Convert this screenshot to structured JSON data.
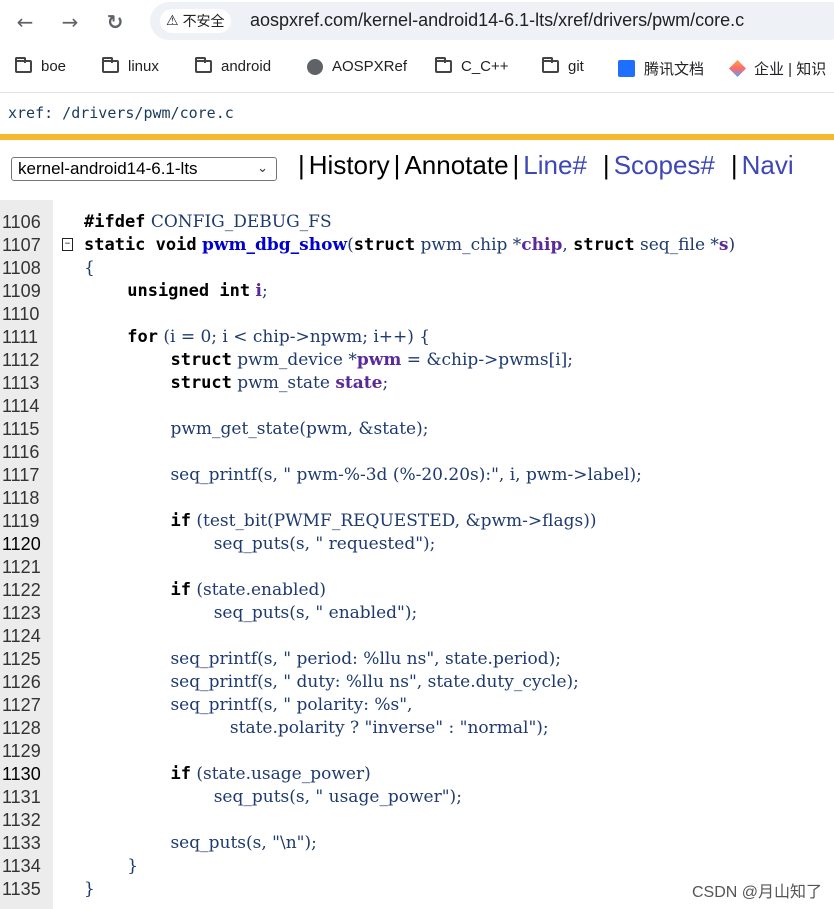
{
  "browser": {
    "back_icon": "arrow-left-icon",
    "forward_icon": "arrow-right-icon",
    "reload_icon": "reload-icon",
    "security_label": "不安全",
    "url": "aospxref.com/kernel-android14-6.1-lts/xref/drivers/pwm/core.c"
  },
  "bookmarks": [
    {
      "label": "boe",
      "icon": "folder-icon"
    },
    {
      "label": "linux",
      "icon": "folder-icon"
    },
    {
      "label": "android",
      "icon": "folder-icon"
    },
    {
      "label": "AOSPXRef",
      "icon": "globe-icon"
    },
    {
      "label": "C_C++",
      "icon": "folder-icon"
    },
    {
      "label": "git",
      "icon": "folder-icon"
    },
    {
      "label": "腾讯文档",
      "icon": "tencent-docs-icon"
    },
    {
      "label": "企业 | 知识",
      "icon": "cube-icon"
    }
  ],
  "xref_path": "xref: /drivers/pwm/core.c",
  "project_select": "kernel-android14-6.1-lts",
  "toolbar": {
    "history": "History",
    "annotate": "Annotate",
    "line": "Line#",
    "scopes": "Scopes#",
    "navigate": "Navi"
  },
  "accent_color": "#f5b82e",
  "code": {
    "lines": [
      {
        "n": "1106",
        "html": "<span class='kw'>#ifdef</span> <span class='id'>CONFIG_DEBUG_FS</span>"
      },
      {
        "n": "1107",
        "fold": true,
        "html": "<span class='kw'>static void</span> <span class='fn'>pwm_dbg_show</span>(<span class='kw'>struct</span> <span class='id'>pwm_chip</span> *<span class='sv'>chip</span>, <span class='kw'>struct</span> <span class='id'>seq_file</span> *<span class='sv'>s</span>)"
      },
      {
        "n": "1108",
        "html": "{"
      },
      {
        "n": "1109",
        "html": "        <span class='kw'>unsigned int</span> <span class='sv'>i</span>;"
      },
      {
        "n": "1110",
        "html": ""
      },
      {
        "n": "1111",
        "html": "        <span class='kw'>for</span> (i = 0; i &lt; chip-&gt;npwm; i++) {"
      },
      {
        "n": "1112",
        "html": "                <span class='kw'>struct</span> <span class='id'>pwm_device</span> *<span class='sv'>pwm</span> = &amp;chip-&gt;pwms[i];"
      },
      {
        "n": "1113",
        "html": "                <span class='kw'>struct</span> <span class='id'>pwm_state</span> <span class='sv'>state</span>;"
      },
      {
        "n": "1114",
        "html": ""
      },
      {
        "n": "1115",
        "html": "                pwm_get_state(pwm, &amp;state);"
      },
      {
        "n": "1116",
        "html": ""
      },
      {
        "n": "1117",
        "html": "                seq_printf(s, \" pwm-%-3d (%-20.20s):\", i, pwm-&gt;label);"
      },
      {
        "n": "1118",
        "html": ""
      },
      {
        "n": "1119",
        "html": "                <span class='kw'>if</span> (test_bit(PWMF_REQUESTED, &amp;pwm-&gt;flags))"
      },
      {
        "n": "1120",
        "hl": true,
        "html": "                        seq_puts(s, \" requested\");"
      },
      {
        "n": "1121",
        "html": ""
      },
      {
        "n": "1122",
        "html": "                <span class='kw'>if</span> (state.enabled)"
      },
      {
        "n": "1123",
        "html": "                        seq_puts(s, \" enabled\");"
      },
      {
        "n": "1124",
        "html": ""
      },
      {
        "n": "1125",
        "html": "                seq_printf(s, \" period: %llu ns\", state.period);"
      },
      {
        "n": "1126",
        "html": "                seq_printf(s, \" duty: %llu ns\", state.duty_cycle);"
      },
      {
        "n": "1127",
        "html": "                seq_printf(s, \" polarity: %s\","
      },
      {
        "n": "1128",
        "html": "                           state.polarity ? \"inverse\" : \"normal\");"
      },
      {
        "n": "1129",
        "html": ""
      },
      {
        "n": "1130",
        "hl": true,
        "html": "                <span class='kw'>if</span> (state.usage_power)"
      },
      {
        "n": "1131",
        "html": "                        seq_puts(s, \" usage_power\");"
      },
      {
        "n": "1132",
        "html": ""
      },
      {
        "n": "1133",
        "html": "                seq_puts(s, \"\\n\");"
      },
      {
        "n": "1134",
        "html": "        }"
      },
      {
        "n": "1135",
        "html": "}"
      }
    ]
  },
  "watermark": "CSDN @月山知了"
}
